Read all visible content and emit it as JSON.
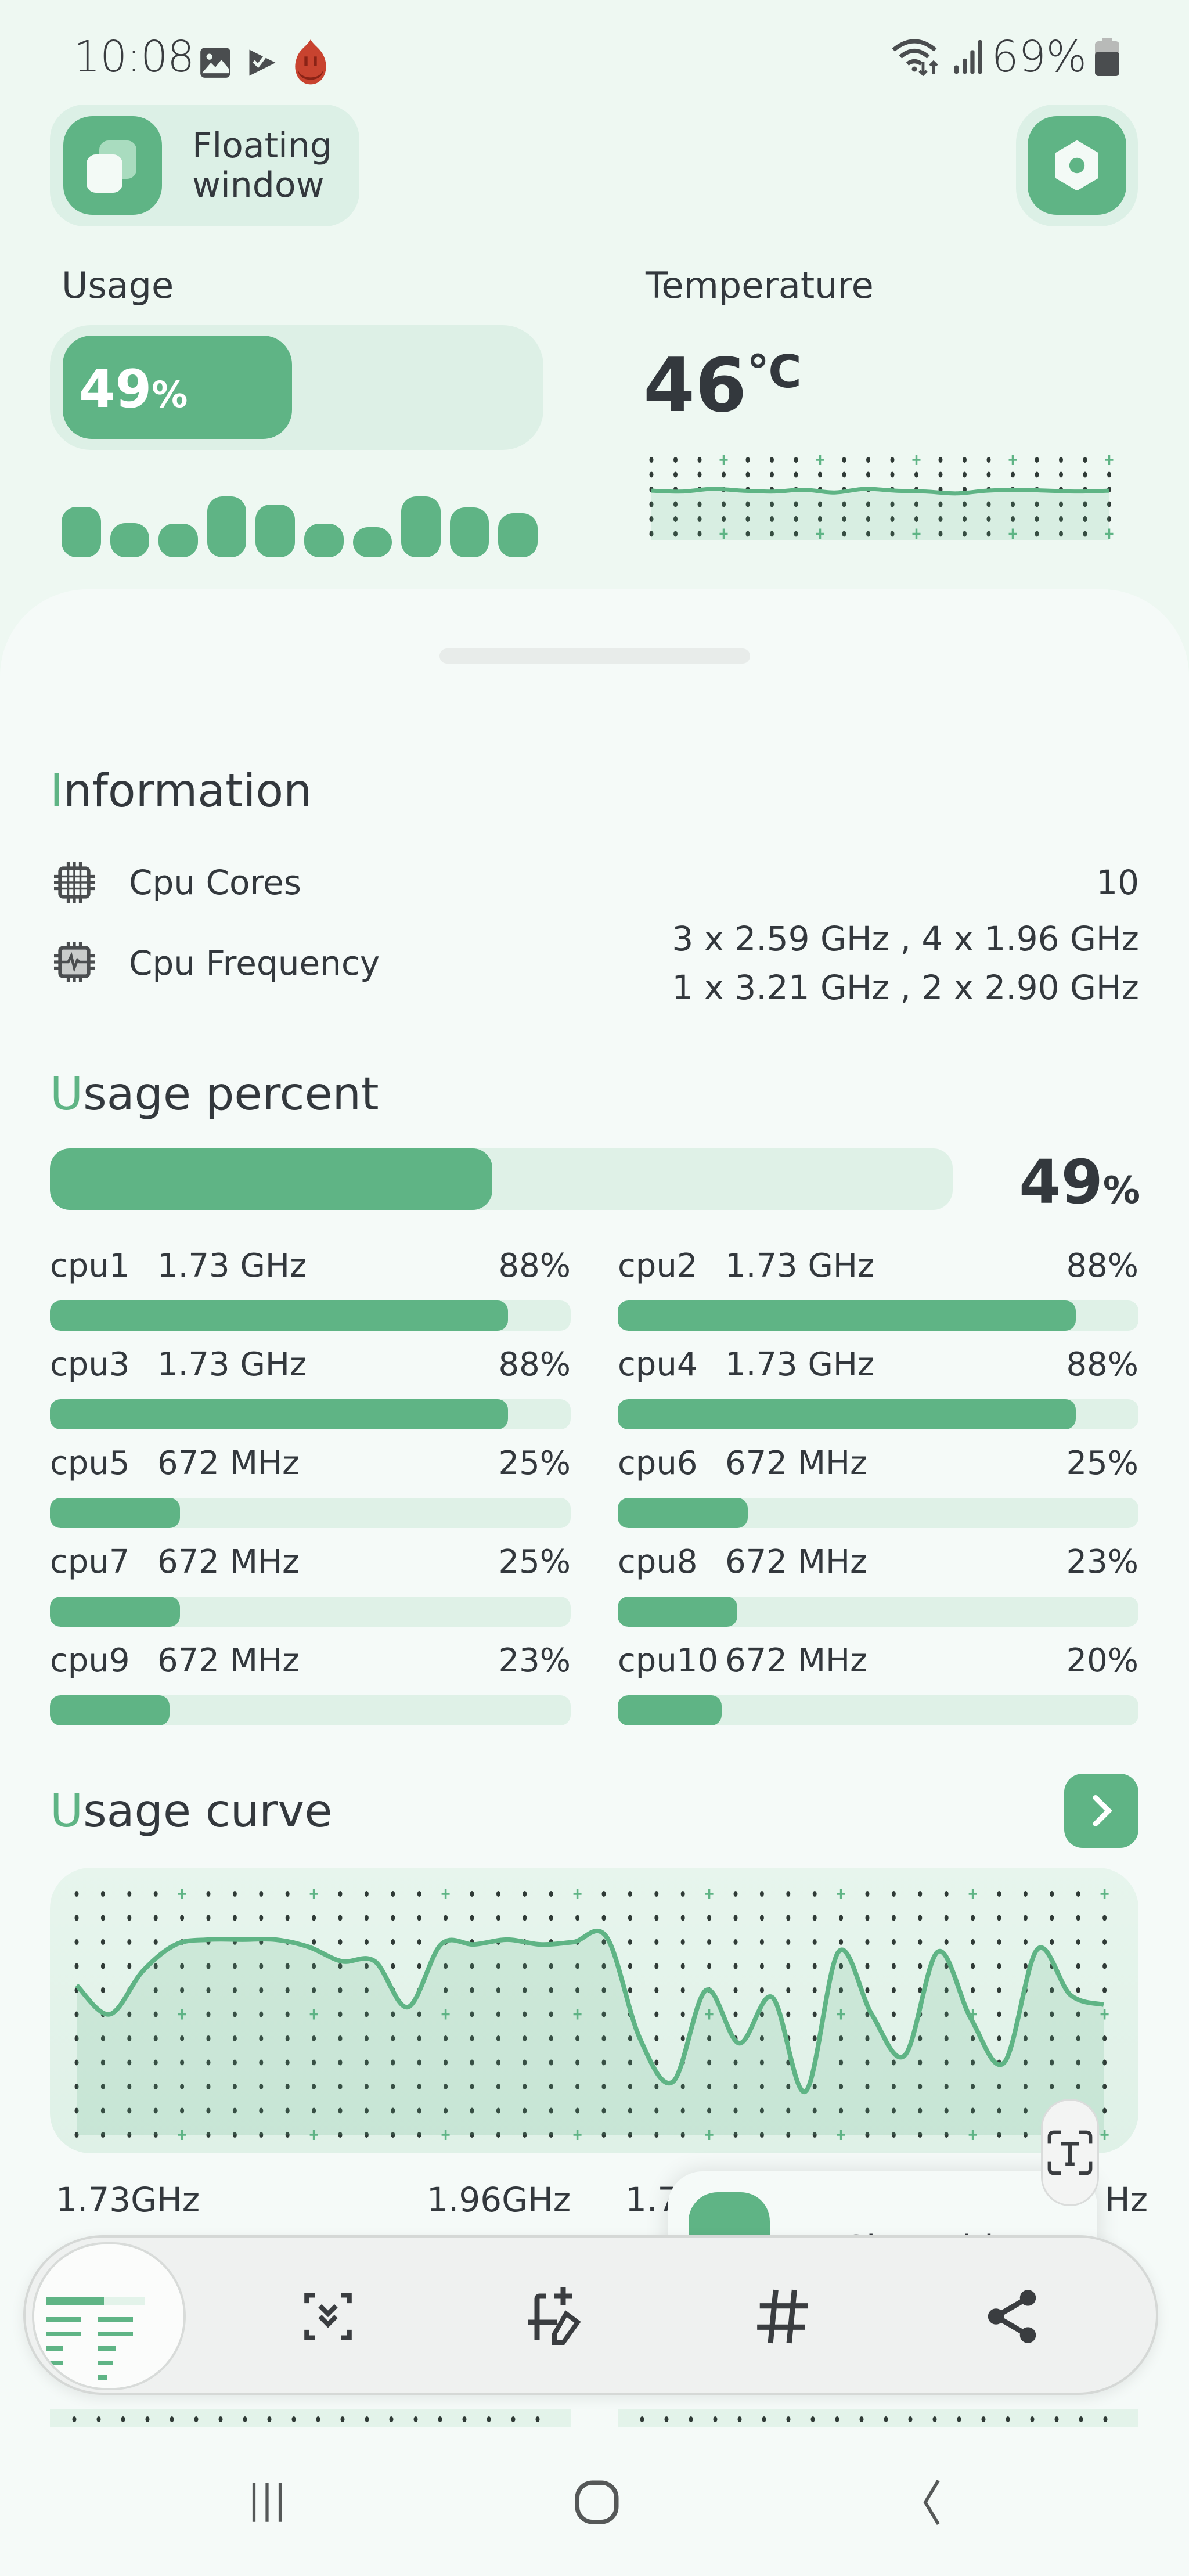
{
  "status_bar": {
    "time": "10:08",
    "left_icons": [
      "gallery-icon",
      "play-store-check-icon",
      "antutu-flame-icon"
    ],
    "right_icons": [
      "wifi-data-icon",
      "signal-bars-icon",
      "battery-icon"
    ],
    "battery_percent": "69%",
    "battery_level": 0.69
  },
  "header": {
    "floating_window_label_line1": "Floating",
    "floating_window_label_line2": "window",
    "settings_icon": "hexagon-settings-icon"
  },
  "usage": {
    "label": "Usage",
    "percent_value": "49",
    "percent_unit": "%",
    "fill_fraction": 0.49,
    "history_bars": [
      0.83,
      0.56,
      0.55,
      1.0,
      0.87,
      0.55,
      0.5,
      1.0,
      0.82,
      0.72
    ]
  },
  "temperature": {
    "label": "Temperature",
    "value": "46",
    "unit": "℃",
    "curve": [
      0.48,
      0.47,
      0.5,
      0.48,
      0.47,
      0.49,
      0.46,
      0.5,
      0.48,
      0.47,
      0.45,
      0.48,
      0.49,
      0.48,
      0.47,
      0.48
    ]
  },
  "information": {
    "heading_first": "I",
    "heading_rest": "nformation",
    "rows": [
      {
        "icon": "cpu-chip-icon",
        "label": "Cpu Cores",
        "value_lines": [
          "10"
        ]
      },
      {
        "icon": "cpu-frequency-icon",
        "label": "Cpu Frequency",
        "value_lines": [
          "3 x 2.59 GHz , 4 x 1.96 GHz",
          "1 x 3.21 GHz , 2 x 2.90 GHz"
        ]
      }
    ]
  },
  "usage_percent": {
    "heading_first": "U",
    "heading_rest": "sage percent",
    "total_value": "49",
    "total_unit": "%",
    "total_fraction": 0.49,
    "cpus": [
      {
        "name": "cpu1",
        "freq": "1.73 GHz",
        "pct": "88%",
        "fraction": 0.88
      },
      {
        "name": "cpu2",
        "freq": "1.73 GHz",
        "pct": "88%",
        "fraction": 0.88
      },
      {
        "name": "cpu3",
        "freq": "1.73 GHz",
        "pct": "88%",
        "fraction": 0.88
      },
      {
        "name": "cpu4",
        "freq": "1.73 GHz",
        "pct": "88%",
        "fraction": 0.88
      },
      {
        "name": "cpu5",
        "freq": "672 MHz",
        "pct": "25%",
        "fraction": 0.25
      },
      {
        "name": "cpu6",
        "freq": "672 MHz",
        "pct": "25%",
        "fraction": 0.25
      },
      {
        "name": "cpu7",
        "freq": "672 MHz",
        "pct": "25%",
        "fraction": 0.25
      },
      {
        "name": "cpu8",
        "freq": "672 MHz",
        "pct": "23%",
        "fraction": 0.23
      },
      {
        "name": "cpu9",
        "freq": "672 MHz",
        "pct": "23%",
        "fraction": 0.23
      },
      {
        "name": "cpu10",
        "freq": "672 MHz",
        "pct": "20%",
        "fraction": 0.2
      }
    ]
  },
  "usage_curve": {
    "heading_first": "U",
    "heading_rest": "sage curve",
    "next_icon": "chevron-right-icon",
    "points": [
      0.62,
      0.5,
      0.68,
      0.79,
      0.81,
      0.81,
      0.81,
      0.78,
      0.72,
      0.72,
      0.53,
      0.79,
      0.79,
      0.81,
      0.79,
      0.8,
      0.82,
      0.4,
      0.22,
      0.6,
      0.38,
      0.57,
      0.18,
      0.76,
      0.5,
      0.33,
      0.76,
      0.48,
      0.3,
      0.77,
      0.58,
      0.54
    ],
    "freq_labels": [
      "1.73GHz",
      "1.96GHz",
      "1.7",
      "Hz"
    ]
  },
  "overlays": {
    "text_capture_icon": "text-extract-icon",
    "cleanable_label": "Cleanable",
    "toolbar_icons": [
      "scroll-capture-icon",
      "crop-edit-icon",
      "hashtag-icon",
      "share-icon"
    ]
  },
  "navigation": {
    "icons": [
      "recent-apps-icon",
      "home-icon",
      "back-icon"
    ]
  }
}
